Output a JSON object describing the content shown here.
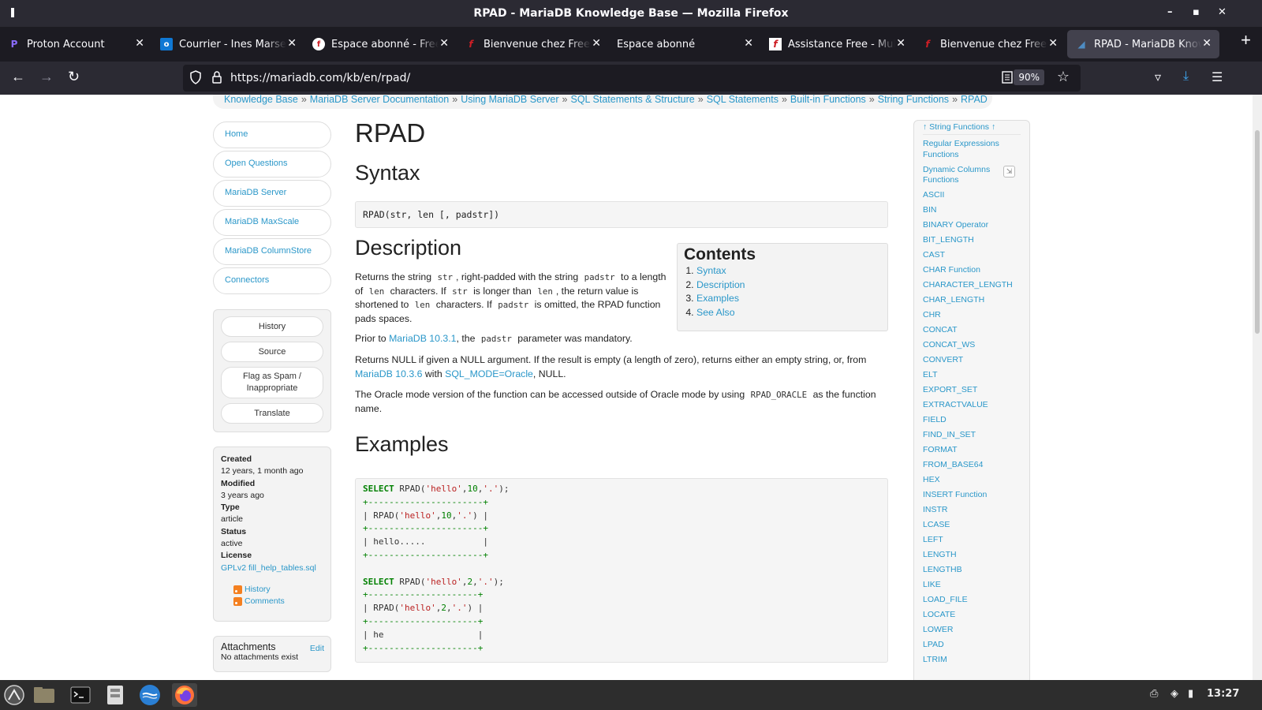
{
  "window": {
    "title": "RPAD - MariaDB Knowledge Base — Mozilla Firefox"
  },
  "tabs": [
    {
      "label": "Proton Account",
      "icon": "proton-icon",
      "color": "#8a6cff"
    },
    {
      "label": "Courrier - Ines Marseille",
      "icon": "outlook-icon",
      "color": "#0f78d4"
    },
    {
      "label": "Espace abonné - Freebox",
      "icon": "freebox-icon",
      "color": "#cd1e25"
    },
    {
      "label": "Bienvenue chez Free mobile",
      "icon": "free-icon",
      "color": "#cd1e25"
    },
    {
      "label": "Espace abonné",
      "icon": "none",
      "color": ""
    },
    {
      "label": "Assistance Free - Multi",
      "icon": "free-icon",
      "color": "#cd1e25"
    },
    {
      "label": "Bienvenue chez Free mobile",
      "icon": "free-icon",
      "color": "#cd1e25"
    },
    {
      "label": "RPAD - MariaDB Knowledge Base",
      "icon": "mariadb-icon",
      "color": "#4e8cc2",
      "active": true
    }
  ],
  "nav": {
    "url": "https://mariadb.com/kb/en/rpad/",
    "zoom": "90%"
  },
  "breadcrumbs": [
    "Knowledge Base",
    "MariaDB Server Documentation",
    "Using MariaDB Server",
    "SQL Statements & Structure",
    "SQL Statements",
    "Built-in Functions",
    "String Functions",
    "RPAD"
  ],
  "left_nav": [
    "Home",
    "Open Questions",
    "MariaDB Server",
    "MariaDB MaxScale",
    "MariaDB ColumnStore",
    "Connectors"
  ],
  "actions": {
    "history": "History",
    "source": "Source",
    "flag_a": "Flag as Spam /",
    "flag_b": "Inappropriate",
    "translate": "Translate"
  },
  "meta": {
    "created_label": "Created",
    "created": "12 years, 1 month ago",
    "modified_label": "Modified",
    "modified": "3 years ago",
    "type_label": "Type",
    "type": "article",
    "status_label": "Status",
    "status": "active",
    "license_label": "License",
    "license": "GPLv2 fill_help_tables.sql",
    "feed_history": "History",
    "feed_comments": "Comments"
  },
  "attachments": {
    "title": "Attachments",
    "edit": "Edit",
    "empty": "No attachments exist"
  },
  "article": {
    "title": "RPAD",
    "syntax_heading": "Syntax",
    "syntax": "RPAD(str, len [, padstr])",
    "description_heading": "Description",
    "desc": {
      "p1_a": "Returns the string",
      "p1_code1": "str",
      "p1_b": ", right-padded with the string",
      "p1_code2": "padstr",
      "p1_c": "to a length of",
      "p1_code3": "len",
      "p1_d": "characters. If",
      "p1_code4": "str",
      "p1_e": "is longer than",
      "p1_code5": "len",
      "p1_f": ", the return value is shortened to",
      "p1_code6": "len",
      "p1_g": "characters. If",
      "p1_code7": "padstr",
      "p1_h": "is omitted, the RPAD function pads spaces.",
      "p2_a": "Prior to",
      "p2_link": "MariaDB 10.3.1",
      "p2_b": ", the",
      "p2_code": "padstr",
      "p2_c": "parameter was mandatory.",
      "p3_a": "Returns NULL if given a NULL argument. If the result is empty (a length of zero), returns either an empty string, or, from",
      "p3_link1": "MariaDB 10.3.6",
      "p3_b": "with",
      "p3_link2": "SQL_MODE=Oracle",
      "p3_c": ", NULL.",
      "p4_a": "The Oracle mode version of the function can be accessed outside of Oracle mode by using",
      "p4_code": "RPAD_ORACLE",
      "p4_b": "as the function name."
    },
    "contents": {
      "title": "Contents",
      "items": [
        "Syntax",
        "Description",
        "Examples",
        "See Also"
      ]
    },
    "examples_heading": "Examples",
    "code": {
      "q1_kw": "SELECT",
      "q1_fn": "RPAD(",
      "q1_s1": "'hello'",
      "q1_n": "10",
      "q1_s2": "'.'",
      "q1_end": ");",
      "border1": "+----------------------+",
      "h1_a": "| RPAD(",
      "h1_s1": "'hello'",
      "h1_n": "10",
      "h1_s2": "'.'",
      "h1_b": ") |",
      "r1": "| hello.....           |",
      "q2_kw": "SELECT",
      "q2_fn": "RPAD(",
      "q2_s1": "'hello'",
      "q2_n": "2",
      "q2_s2": "'.'",
      "q2_end": ");",
      "border2": "+---------------------+",
      "h2_a": "| RPAD(",
      "h2_s1": "'hello'",
      "h2_n": "2",
      "h2_s2": "'.'",
      "h2_b": ") |",
      "r2": "| he                  |"
    }
  },
  "right_nav": {
    "top": "↑ String Functions ↑",
    "items": [
      "Regular Expressions Functions",
      "Dynamic Columns Functions",
      "ASCII",
      "BIN",
      "BINARY Operator",
      "BIT_LENGTH",
      "CAST",
      "CHAR Function",
      "CHARACTER_LENGTH",
      "CHAR_LENGTH",
      "CHR",
      "CONCAT",
      "CONCAT_WS",
      "CONVERT",
      "ELT",
      "EXPORT_SET",
      "EXTRACTVALUE",
      "FIELD",
      "FIND_IN_SET",
      "FORMAT",
      "FROM_BASE64",
      "HEX",
      "INSERT Function",
      "INSTR",
      "LCASE",
      "LEFT",
      "LENGTH",
      "LENGTHB",
      "LIKE",
      "LOAD_FILE",
      "LOCATE",
      "LOWER",
      "LPAD",
      "LTRIM"
    ]
  },
  "taskbar": {
    "clock": "13:27"
  }
}
